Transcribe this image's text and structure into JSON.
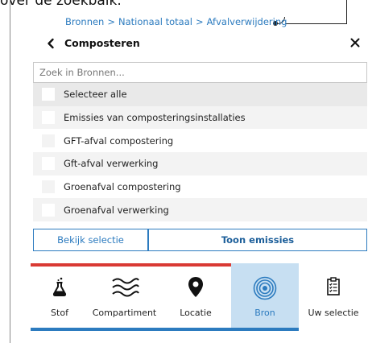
{
  "top_text": "over de zoekbalk.",
  "breadcrumb": {
    "items": [
      "Bronnen",
      "Nationaal totaal",
      "Afvalverwijdering"
    ],
    "separator": ">"
  },
  "header": {
    "title": "Composteren"
  },
  "search": {
    "placeholder": "Zoek in Bronnen...",
    "value": ""
  },
  "list": {
    "items": [
      "Selecteer alle",
      "Emissies van composteringsinstallaties",
      "GFT-afval compostering",
      "Gft-afval verwerking",
      "Groenafval compostering",
      "Groenafval verwerking"
    ]
  },
  "buttons": {
    "view_selection": "Bekijk selectie",
    "show_emissions": "Toon emissies"
  },
  "tabs": [
    {
      "label": "Stof",
      "icon": "flask-icon"
    },
    {
      "label": "Compartiment",
      "icon": "waves-icon"
    },
    {
      "label": "Locatie",
      "icon": "map-pin-icon"
    },
    {
      "label": "Bron",
      "icon": "target-icon",
      "active": true
    },
    {
      "label": "Uw selectie",
      "icon": "clipboard-icon"
    }
  ],
  "colors": {
    "accent": "#2c7bbf",
    "tab_top": "#d93a34",
    "active_tab_bg": "#c7dff2"
  }
}
